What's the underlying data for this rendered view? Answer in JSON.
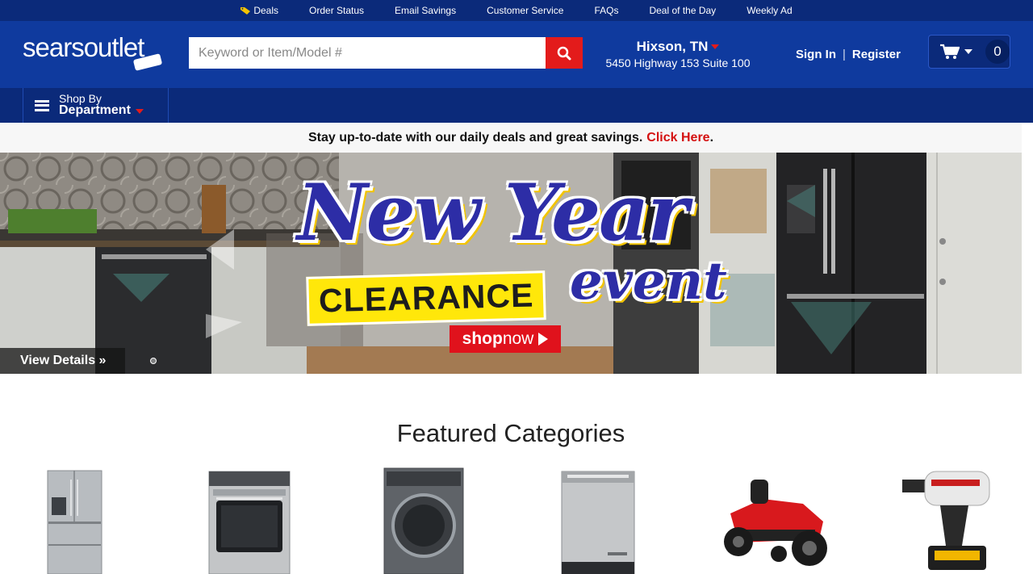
{
  "topbar": {
    "links": [
      {
        "label": "Deals",
        "icon": "tag-icon"
      },
      {
        "label": "Order Status"
      },
      {
        "label": "Email Savings"
      },
      {
        "label": "Customer Service"
      },
      {
        "label": "FAQs"
      },
      {
        "label": "Deal of the Day"
      },
      {
        "label": "Weekly Ad"
      }
    ]
  },
  "header": {
    "logo": "searsoutlet",
    "search_placeholder": "Keyword or Item/Model #",
    "location_city": "Hixson, TN",
    "location_address": "5450 Highway 153 Suite 100",
    "sign_in": "Sign In",
    "separator": "|",
    "register": "Register",
    "cart_count": "0"
  },
  "nav": {
    "shop_by": "Shop By",
    "department": "Department"
  },
  "promo": {
    "text": "Stay up-to-date with our daily deals and great savings.",
    "link": "Click Here",
    "end": "."
  },
  "hero": {
    "title": "New Year",
    "band": "CLEARANCE",
    "event": "event",
    "shop": "shop",
    "now": "now",
    "view_details": "View Details »"
  },
  "featured": {
    "title": "Featured Categories"
  },
  "colors": {
    "topbar": "#0b2a7a",
    "header": "#0f3a9e",
    "accent_red": "#e31b1b",
    "hero_blue": "#2d2da6",
    "hero_yellow": "#ffe70a"
  }
}
